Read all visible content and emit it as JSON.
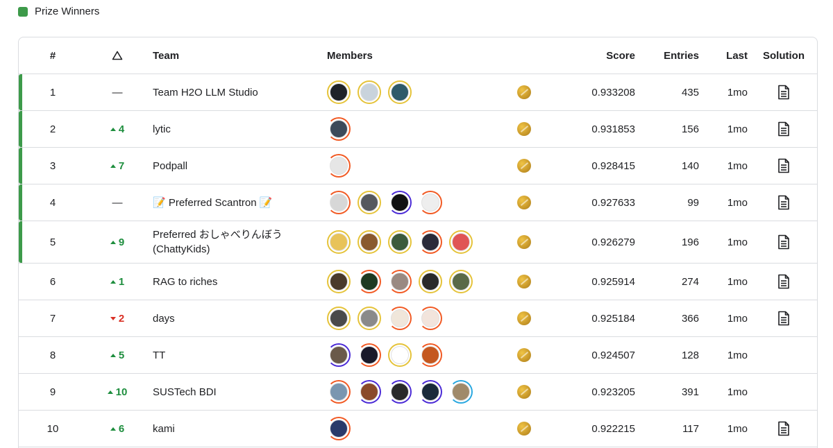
{
  "legend": {
    "label": "Prize Winners",
    "color": "#3d9a4a"
  },
  "header": {
    "rank": "#",
    "delta_icon": "triangle-icon",
    "team": "Team",
    "members": "Members",
    "score": "Score",
    "entries": "Entries",
    "last": "Last",
    "solution": "Solution"
  },
  "rows": [
    {
      "rank": "1",
      "delta_dir": "none",
      "delta": "—",
      "team": "Team H2O LLM Studio",
      "prize": true,
      "members": [
        {
          "ring": "gold",
          "fill": "#1f2329"
        },
        {
          "ring": "gold",
          "fill": "#c9d3dc"
        },
        {
          "ring": "gold",
          "fill": "#2e5a6a"
        }
      ],
      "medal": "gold-medal-icon",
      "score": "0.933208",
      "entries": "435",
      "last": "1mo",
      "solution": true
    },
    {
      "rank": "2",
      "delta_dir": "up",
      "delta": "4",
      "team": "lytic",
      "prize": true,
      "members": [
        {
          "ring": "orange",
          "fill": "#3d4a5a"
        }
      ],
      "medal": "gold-medal-icon",
      "score": "0.931853",
      "entries": "156",
      "last": "1mo",
      "solution": true
    },
    {
      "rank": "3",
      "delta_dir": "up",
      "delta": "7",
      "team": "Podpall",
      "prize": true,
      "members": [
        {
          "ring": "orange",
          "fill": "#e6e6e6"
        }
      ],
      "medal": "gold-medal-icon",
      "score": "0.928415",
      "entries": "140",
      "last": "1mo",
      "solution": true
    },
    {
      "rank": "4",
      "delta_dir": "none",
      "delta": "—",
      "team": "📝 Preferred Scantron 📝",
      "prize": true,
      "members": [
        {
          "ring": "orange",
          "fill": "#d7d7d7"
        },
        {
          "ring": "gold",
          "fill": "#55585e"
        },
        {
          "ring": "purple",
          "fill": "#111111"
        },
        {
          "ring": "orange",
          "fill": "#eeeeee"
        }
      ],
      "medal": "gold-medal-icon",
      "score": "0.927633",
      "entries": "99",
      "last": "1mo",
      "solution": true
    },
    {
      "rank": "5",
      "delta_dir": "up",
      "delta": "9",
      "team": "Preferred おしゃべりんぼう(ChattyKids)",
      "prize": true,
      "members": [
        {
          "ring": "gold",
          "fill": "#e8c35a"
        },
        {
          "ring": "gold",
          "fill": "#8a5a2e"
        },
        {
          "ring": "gold",
          "fill": "#3c5a3c"
        },
        {
          "ring": "orange",
          "fill": "#2b2b3a"
        },
        {
          "ring": "gold",
          "fill": "#e05555"
        }
      ],
      "medal": "gold-medal-icon",
      "score": "0.926279",
      "entries": "196",
      "last": "1mo",
      "solution": true
    },
    {
      "rank": "6",
      "delta_dir": "up",
      "delta": "1",
      "team": "RAG to riches",
      "prize": false,
      "members": [
        {
          "ring": "gold",
          "fill": "#4a3a2a"
        },
        {
          "ring": "orange",
          "fill": "#1e3a22"
        },
        {
          "ring": "orange",
          "fill": "#9a8a82"
        },
        {
          "ring": "gold",
          "fill": "#2a2a2a"
        },
        {
          "ring": "gold",
          "fill": "#5a6a48"
        }
      ],
      "medal": "gold-medal-icon",
      "score": "0.925914",
      "entries": "274",
      "last": "1mo",
      "solution": true
    },
    {
      "rank": "7",
      "delta_dir": "down",
      "delta": "2",
      "team": "days",
      "prize": false,
      "members": [
        {
          "ring": "gold",
          "fill": "#4a4a4a"
        },
        {
          "ring": "gold",
          "fill": "#8a8a8a"
        },
        {
          "ring": "orange",
          "fill": "#f0e6da"
        },
        {
          "ring": "orange",
          "fill": "#f2e4dc"
        }
      ],
      "medal": "gold-medal-icon",
      "score": "0.925184",
      "entries": "366",
      "last": "1mo",
      "solution": true
    },
    {
      "rank": "8",
      "delta_dir": "up",
      "delta": "5",
      "team": "TT",
      "prize": false,
      "members": [
        {
          "ring": "purple",
          "fill": "#6a5a4a"
        },
        {
          "ring": "orange",
          "fill": "#1a1a2a"
        },
        {
          "ring": "gold",
          "fill": "#ffffff"
        },
        {
          "ring": "orange",
          "fill": "#c4581f"
        }
      ],
      "medal": "gold-medal-icon",
      "score": "0.924507",
      "entries": "128",
      "last": "1mo",
      "solution": false
    },
    {
      "rank": "9",
      "delta_dir": "up",
      "delta": "10",
      "team": "SUSTech BDI",
      "prize": false,
      "members": [
        {
          "ring": "orange",
          "fill": "#7a96b0"
        },
        {
          "ring": "purple",
          "fill": "#8a4a2a"
        },
        {
          "ring": "purple",
          "fill": "#2a2a2a"
        },
        {
          "ring": "purple",
          "fill": "#1a2a3a"
        },
        {
          "ring": "blue",
          "fill": "#a08a6a"
        }
      ],
      "medal": "gold-medal-icon",
      "score": "0.923205",
      "entries": "391",
      "last": "1mo",
      "solution": false
    },
    {
      "rank": "10",
      "delta_dir": "up",
      "delta": "6",
      "team": "kami",
      "prize": false,
      "members": [
        {
          "ring": "orange",
          "fill": "#2a3a6a"
        }
      ],
      "medal": "gold-medal-icon",
      "score": "0.922215",
      "entries": "117",
      "last": "1mo",
      "solution": true
    }
  ],
  "ring_colors": {
    "gold": "#e5c33a",
    "orange": "#f15a24",
    "purple": "#4b2bd6",
    "blue": "#2aa8e0"
  },
  "solution_icon": "document-icon"
}
